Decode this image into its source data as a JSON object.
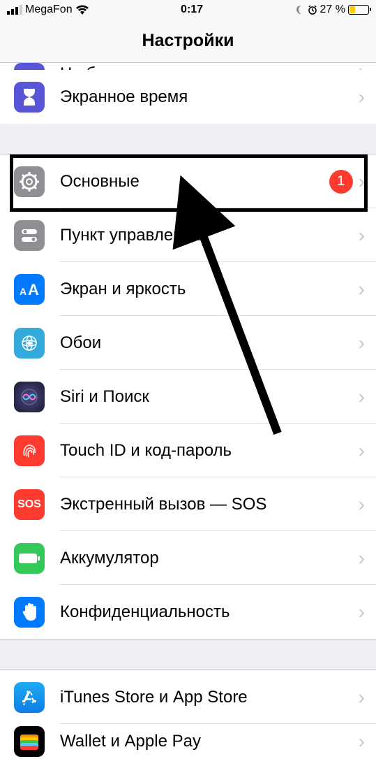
{
  "status": {
    "carrier": "MegaFon",
    "time": "0:17",
    "battery_pct": "27 %",
    "battery_level": 27
  },
  "header": {
    "title": "Настройки"
  },
  "partial_top": {
    "label": "Не беспокоить"
  },
  "group1": {
    "items": [
      {
        "label": "Экранное время",
        "icon": "hourglass",
        "color": "#5856d6"
      }
    ]
  },
  "group2": {
    "items": [
      {
        "label": "Основные",
        "icon": "gear",
        "color": "#8e8e93",
        "badge": "1"
      },
      {
        "label": "Пункт управления",
        "icon": "switches",
        "color": "#8e8e93"
      },
      {
        "label": "Экран и яркость",
        "icon": "textsize",
        "color": "#007aff"
      },
      {
        "label": "Обои",
        "icon": "wallpaper",
        "color": "#43c4db"
      },
      {
        "label": "Siri и Поиск",
        "icon": "siri",
        "color": "#1a1a2e"
      },
      {
        "label": "Touch ID и код-пароль",
        "icon": "fingerprint",
        "color": "#ff3b30"
      },
      {
        "label": "Экстренный вызов — SOS",
        "icon": "sos",
        "color": "#ff3b30"
      },
      {
        "label": "Аккумулятор",
        "icon": "battery",
        "color": "#34c759"
      },
      {
        "label": "Конфиденциальность",
        "icon": "hand",
        "color": "#007aff"
      }
    ]
  },
  "group3": {
    "items": [
      {
        "label": "iTunes Store и App Store",
        "icon": "appstore",
        "color": "#1eaaf1"
      },
      {
        "label": "Wallet и Apple Pay",
        "icon": "wallet",
        "color": "#000"
      }
    ]
  }
}
